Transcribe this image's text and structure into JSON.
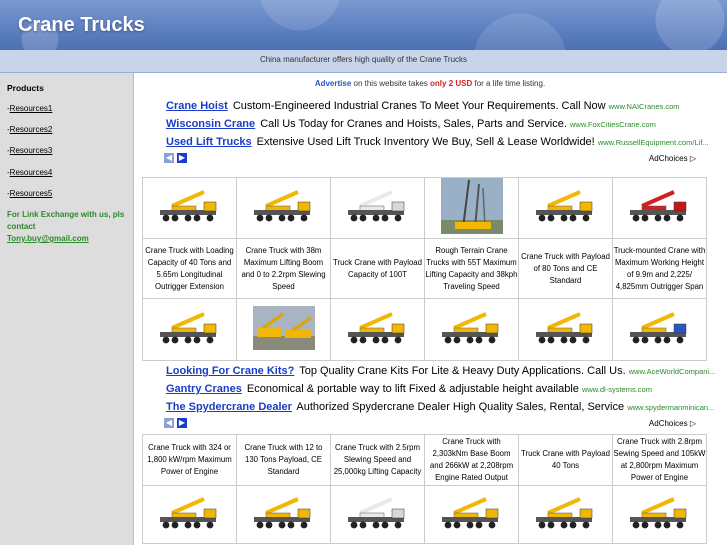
{
  "header": {
    "title": "Crane Trucks"
  },
  "tagline": "China manufacturer offers high quality of the Crane Trucks",
  "sidebar": {
    "heading": "Products",
    "links": [
      "Resources1",
      "Resources2",
      "Resources3",
      "Resources4",
      "Resources5"
    ],
    "exchange_text": "For Link Exchange with us, pls contact",
    "exchange_email": "Tony.buy@gmail.com"
  },
  "advertise": {
    "link": "Advertise",
    "pre": " on this website takes ",
    "only": "only",
    "price": "2 USD",
    "post": " for a life time listing."
  },
  "ads_top": [
    {
      "title": "Crane Hoist",
      "text": "Custom-Engineered Industrial Cranes To Meet Your Requirements. Call Now",
      "url": "www.NAICranes.com"
    },
    {
      "title": "Wisconsin Crane",
      "text": "Call Us Today for Cranes and Hoists, Sales, Parts and Service.",
      "url": "www.FoxCitiesCrane.com"
    },
    {
      "title": "Used Lift Trucks",
      "text": "Extensive Used Lift Truck Inventory We Buy, Sell & Lease Worldwide!",
      "url": "www.RussellEquipment.com/Lif..."
    }
  ],
  "ads_middle": [
    {
      "title": "Looking For Crane Kits?",
      "text": "Top Quality Crane Kits For Lite & Heavy Duty Applications. Call Us.",
      "url": "www.AceWorldCompani..."
    },
    {
      "title": "Gantry Cranes",
      "text": "Economical & portable way to lift Fixed & adjustable height available",
      "url": "www.dl-systems.com"
    },
    {
      "title": "The Spydercrane Dealer",
      "text": "Authorized Spydercrane Dealer High Quality Sales, Rental, Service",
      "url": "www.spydermanminican..."
    }
  ],
  "adchoices": "AdChoices",
  "products_row1": [
    "Crane Truck with Loading Capacity of 40 Tons and 5.65m Longitudinal Outrigger Extension",
    "Crane Truck with 38m Maximum Lifting Boom and 0 to 2.2rpm Slewing Speed",
    "Truck Crane with Payload Capacity of 100T",
    "Rough Terrain Crane Trucks with 55T Maximum Lifting Capacity and 38kph Traveling Speed",
    "Crane Truck with Payload of 80 Tons and CE Standard",
    "Truck-mounted Crane with Maximum Working Height of 9.9m and 2,225/ 4,825mm Outrigger Span"
  ],
  "products_row2": [
    "Crane Truck with 324 or 1,800 kW/rpm Maximum Power of Engine",
    "Crane Truck with 12 to 130 Tons Payload, CE Standard",
    "Crane Truck with 2.5rpm Slewing Speed and 25,000kg Lifting Capacity",
    "Crane Truck with 2,303kNm Base Boom and 266kW at 2,208rpm Engine Rated Output",
    "Truck Crane with Payload 40 Tons",
    "Crane Truck with 2.8rpm Sewing Speed and 105kW at 2,800rpm Maximum Power of Engine"
  ],
  "images_row1": [
    "yellow crane truck photo",
    "yellow crane truck photo",
    "white crane truck photo",
    "tall boom crane photo",
    "yellow crane truck photo",
    "red truck-mounted crane photo"
  ],
  "images_row2": [
    "yellow crane truck photo",
    "yellow crane trucks on site photo",
    "yellow crane truck photo",
    "yellow crane truck photo",
    "yellow crane truck photo",
    "yellow crane truck blue cab photo"
  ],
  "images_row3": [
    "yellow crane truck photo",
    "yellow crane truck photo",
    "white crane truck photo",
    "yellow crane truck photo",
    "yellow crane truck photo",
    "yellow crane truck photo"
  ]
}
